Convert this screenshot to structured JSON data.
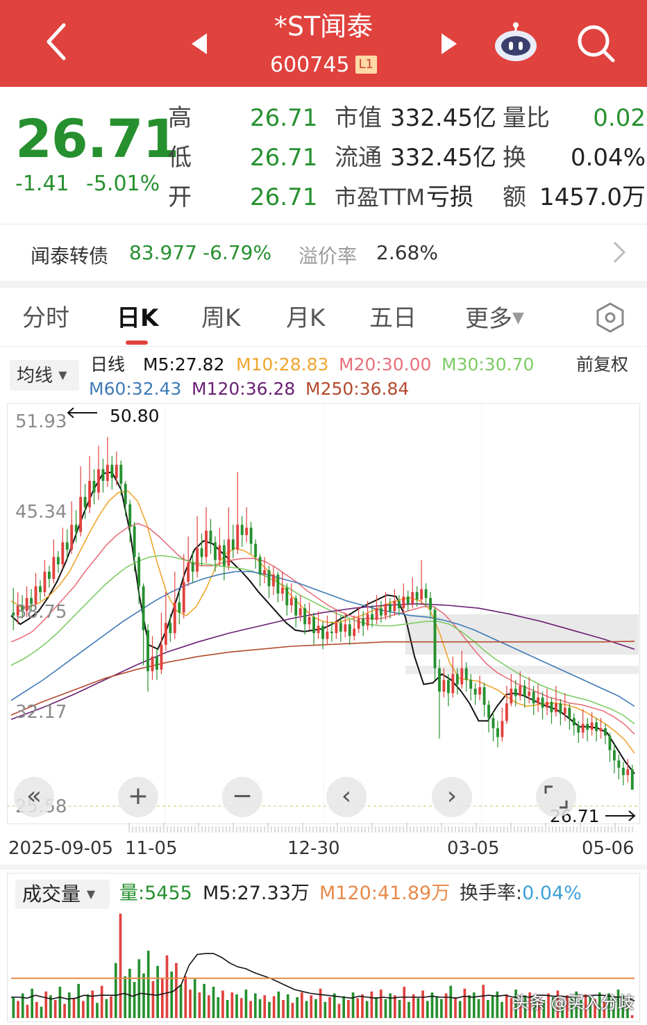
{
  "header": {
    "title": "*ST闻泰",
    "code": "600745",
    "level_badge": "L1"
  },
  "quote": {
    "price": "26.71",
    "change": "-1.41",
    "change_pct": "-5.01%",
    "high_label": "高",
    "high": "26.71",
    "low_label": "低",
    "low": "26.71",
    "open_label": "开",
    "open": "26.71",
    "mktcap_label": "市值",
    "mktcap": "332.45亿",
    "float_label": "流通",
    "float": "332.45亿",
    "pe_label": "市盈TTM",
    "pe": "亏损",
    "volratio_label": "量比",
    "volratio": "0.02",
    "turnover_label": "换",
    "turnover": "0.04%",
    "amount_label": "额",
    "amount": "1457.0万"
  },
  "bond": {
    "name": "闻泰转债",
    "price": "83.977",
    "change_pct": "-6.79%",
    "premium_label": "溢价率",
    "premium": "2.68%"
  },
  "tabs": [
    "分时",
    "日K",
    "周K",
    "月K",
    "五日",
    "更多"
  ],
  "ma_legend": {
    "selector": "均线",
    "prefix": "日线",
    "m5": "M5:27.82",
    "m10": "M10:28.83",
    "m20": "M20:30.00",
    "m30": "M30:30.70",
    "m60": "M60:32.43",
    "m120": "M120:36.28",
    "m250": "M250:36.84",
    "adjust": "前复权"
  },
  "colors": {
    "up": "#e0423e",
    "down": "#26902f",
    "m5": "#111111",
    "m10": "#f0a52c",
    "m20": "#e8707b",
    "m30": "#7ccc63",
    "m60": "#3f7ab8",
    "m120": "#6a1f74",
    "m250": "#b24a2c"
  },
  "chart": {
    "y_ticks": [
      "51.93",
      "45.34",
      "38.75",
      "32.17",
      "25.58"
    ],
    "x_ticks": [
      "2025-09-05",
      "11-05",
      "12-30",
      "03-05",
      "05-06"
    ],
    "max_label": "50.80",
    "last_label": "26.71"
  },
  "chart_data": {
    "type": "candlestick",
    "y_range": [
      25.58,
      51.93
    ],
    "candles": [
      [
        38.8,
        38.6,
        40.5,
        37.6
      ],
      [
        38.6,
        39.3,
        40.2,
        38.0
      ],
      [
        39.3,
        38.9,
        40.0,
        38.4
      ],
      [
        38.9,
        39.8,
        40.6,
        38.5
      ],
      [
        39.8,
        39.4,
        40.4,
        38.9
      ],
      [
        39.4,
        40.6,
        41.5,
        39.0
      ],
      [
        40.6,
        40.2,
        41.0,
        39.6
      ],
      [
        40.2,
        41.6,
        42.4,
        39.9
      ],
      [
        41.6,
        41.1,
        42.0,
        40.5
      ],
      [
        41.1,
        42.6,
        43.8,
        40.8
      ],
      [
        42.6,
        42.1,
        43.0,
        41.5
      ],
      [
        42.1,
        43.6,
        44.6,
        41.8
      ],
      [
        43.6,
        43.1,
        44.5,
        42.4
      ],
      [
        43.1,
        44.8,
        46.4,
        42.8
      ],
      [
        44.8,
        44.3,
        45.8,
        43.6
      ],
      [
        44.3,
        46.7,
        48.8,
        44.0
      ],
      [
        46.7,
        46.0,
        47.6,
        45.2
      ],
      [
        46.0,
        47.8,
        49.5,
        45.6
      ],
      [
        47.8,
        47.0,
        48.6,
        46.2
      ],
      [
        47.0,
        48.6,
        50.2,
        46.5
      ],
      [
        48.6,
        47.8,
        49.3,
        47.0
      ],
      [
        47.8,
        48.9,
        50.8,
        47.4
      ],
      [
        48.9,
        48.0,
        49.5,
        47.2
      ],
      [
        48.0,
        48.9,
        49.8,
        47.5
      ],
      [
        48.9,
        47.6,
        49.2,
        46.8
      ],
      [
        47.6,
        46.2,
        47.8,
        45.4
      ],
      [
        46.2,
        44.7,
        46.5,
        43.6
      ],
      [
        44.7,
        42.6,
        45.0,
        41.6
      ],
      [
        42.6,
        40.6,
        42.9,
        39.4
      ],
      [
        40.6,
        37.6,
        40.8,
        35.2
      ],
      [
        37.6,
        34.8,
        38.0,
        33.4
      ],
      [
        34.8,
        35.8,
        37.2,
        34.2
      ],
      [
        35.8,
        34.9,
        36.4,
        34.2
      ],
      [
        34.9,
        36.6,
        38.8,
        34.6
      ],
      [
        36.6,
        38.1,
        40.2,
        36.2
      ],
      [
        38.1,
        37.4,
        38.7,
        36.8
      ],
      [
        37.4,
        39.5,
        41.6,
        37.0
      ],
      [
        39.5,
        38.8,
        40.3,
        38.0
      ],
      [
        38.8,
        40.9,
        42.8,
        38.4
      ],
      [
        40.9,
        42.2,
        44.0,
        40.6
      ],
      [
        42.2,
        41.6,
        43.0,
        40.8
      ],
      [
        41.6,
        43.2,
        45.4,
        41.2
      ],
      [
        43.2,
        42.6,
        44.2,
        42.0
      ],
      [
        42.6,
        44.4,
        46.0,
        42.2
      ],
      [
        44.4,
        43.6,
        45.2,
        42.8
      ],
      [
        43.6,
        42.4,
        44.0,
        41.6
      ],
      [
        42.4,
        43.4,
        44.6,
        42.0
      ],
      [
        43.4,
        42.0,
        43.8,
        41.0
      ],
      [
        42.0,
        43.8,
        46.0,
        41.7
      ],
      [
        43.8,
        43.1,
        44.8,
        42.5
      ],
      [
        43.1,
        44.8,
        48.4,
        42.8
      ],
      [
        44.8,
        44.1,
        45.4,
        43.3
      ],
      [
        44.1,
        44.6,
        46.0,
        43.6
      ],
      [
        44.6,
        43.5,
        45.0,
        42.8
      ],
      [
        43.5,
        42.6,
        43.8,
        41.8
      ],
      [
        42.6,
        41.4,
        42.8,
        40.6
      ],
      [
        41.4,
        41.7,
        42.6,
        40.8
      ],
      [
        41.7,
        40.6,
        42.0,
        39.8
      ],
      [
        40.6,
        41.4,
        42.0,
        40.0
      ],
      [
        41.4,
        40.1,
        41.6,
        39.5
      ],
      [
        40.1,
        40.5,
        41.6,
        39.6
      ],
      [
        40.5,
        39.3,
        40.8,
        38.6
      ],
      [
        39.3,
        39.8,
        40.8,
        38.8
      ],
      [
        39.8,
        38.6,
        40.0,
        37.8
      ],
      [
        38.6,
        39.1,
        40.0,
        38.2
      ],
      [
        39.1,
        38.0,
        39.4,
        37.3
      ],
      [
        38.0,
        38.5,
        39.5,
        37.6
      ],
      [
        38.5,
        37.4,
        38.8,
        36.6
      ],
      [
        37.4,
        37.9,
        38.9,
        37.0
      ],
      [
        37.9,
        37.0,
        38.2,
        36.3
      ],
      [
        37.0,
        37.5,
        38.6,
        36.6
      ],
      [
        37.5,
        37.4,
        38.2,
        36.8
      ],
      [
        37.4,
        38.1,
        39.0,
        37.0
      ],
      [
        38.1,
        37.5,
        38.6,
        36.8
      ],
      [
        37.5,
        38.0,
        38.8,
        37.1
      ],
      [
        38.0,
        37.2,
        38.3,
        36.6
      ],
      [
        37.2,
        37.7,
        38.6,
        36.9
      ],
      [
        37.7,
        38.4,
        39.2,
        37.4
      ],
      [
        38.4,
        37.9,
        38.9,
        37.2
      ],
      [
        37.9,
        38.7,
        39.6,
        37.6
      ],
      [
        38.7,
        38.3,
        39.3,
        37.8
      ],
      [
        38.3,
        39.1,
        40.0,
        38.0
      ],
      [
        39.1,
        38.6,
        39.6,
        38.1
      ],
      [
        38.6,
        39.4,
        40.2,
        38.3
      ],
      [
        39.4,
        38.9,
        39.8,
        38.4
      ],
      [
        38.9,
        39.6,
        40.4,
        38.6
      ],
      [
        39.6,
        39.1,
        40.0,
        38.6
      ],
      [
        39.1,
        39.9,
        40.8,
        38.8
      ],
      [
        39.9,
        39.4,
        40.3,
        38.9
      ],
      [
        39.4,
        40.2,
        41.2,
        39.1
      ],
      [
        40.2,
        39.7,
        40.6,
        39.2
      ],
      [
        39.7,
        40.4,
        42.4,
        39.4
      ],
      [
        40.4,
        39.8,
        40.8,
        39.2
      ],
      [
        39.8,
        39.0,
        40.2,
        38.4
      ],
      [
        39.0,
        35.0,
        39.2,
        34.2
      ],
      [
        35.0,
        33.4,
        35.6,
        30.2
      ],
      [
        33.4,
        34.2,
        35.0,
        33.0
      ],
      [
        34.2,
        33.3,
        34.6,
        32.4
      ],
      [
        33.3,
        34.6,
        35.8,
        33.0
      ],
      [
        34.6,
        33.9,
        35.0,
        33.2
      ],
      [
        33.9,
        35.0,
        36.2,
        33.6
      ],
      [
        35.0,
        34.2,
        35.4,
        33.4
      ],
      [
        34.2,
        33.6,
        34.6,
        32.8
      ],
      [
        33.6,
        33.2,
        34.0,
        32.5
      ],
      [
        33.2,
        33.7,
        34.5,
        32.8
      ],
      [
        33.7,
        32.5,
        34.0,
        31.7
      ],
      [
        32.5,
        31.6,
        32.8,
        30.6
      ],
      [
        31.6,
        30.9,
        32.0,
        30.0
      ],
      [
        30.9,
        30.3,
        31.4,
        29.6
      ],
      [
        30.3,
        31.4,
        32.3,
        30.0
      ],
      [
        31.4,
        32.6,
        33.8,
        31.2
      ],
      [
        32.6,
        33.6,
        34.6,
        32.4
      ],
      [
        33.6,
        33.1,
        34.2,
        32.4
      ],
      [
        33.1,
        33.8,
        34.8,
        32.8
      ],
      [
        33.8,
        33.1,
        34.2,
        32.3
      ],
      [
        33.1,
        33.4,
        34.4,
        32.6
      ],
      [
        33.4,
        32.6,
        33.8,
        31.8
      ],
      [
        32.6,
        33.0,
        33.9,
        32.0
      ],
      [
        33.0,
        32.3,
        33.4,
        31.5
      ],
      [
        32.3,
        32.7,
        33.6,
        31.8
      ],
      [
        32.7,
        32.0,
        33.0,
        31.2
      ],
      [
        32.0,
        32.6,
        33.8,
        31.7
      ],
      [
        32.6,
        31.9,
        32.9,
        31.1
      ],
      [
        31.9,
        32.3,
        33.3,
        31.4
      ],
      [
        32.3,
        31.6,
        32.6,
        30.8
      ],
      [
        31.6,
        31.1,
        31.9,
        30.4
      ],
      [
        31.1,
        30.6,
        31.4,
        29.9
      ],
      [
        30.6,
        31.2,
        32.2,
        30.2
      ],
      [
        31.2,
        30.8,
        31.6,
        30.0
      ],
      [
        30.8,
        31.3,
        32.0,
        30.4
      ],
      [
        31.3,
        30.7,
        31.6,
        30.0
      ],
      [
        30.7,
        30.9,
        31.6,
        30.2
      ],
      [
        30.9,
        30.4,
        31.2,
        29.8
      ],
      [
        30.4,
        29.4,
        30.6,
        28.6
      ],
      [
        29.4,
        28.7,
        29.8,
        27.8
      ],
      [
        28.7,
        28.2,
        29.1,
        27.4
      ],
      [
        28.2,
        27.7,
        28.6,
        27.0
      ],
      [
        27.7,
        28.1,
        28.8,
        27.2
      ],
      [
        28.1,
        26.7,
        28.4,
        26.7
      ]
    ],
    "ma": {
      "M5": [
        38.6,
        38.0,
        38.4,
        38.9,
        39.8,
        40.9,
        42.3,
        44.0,
        45.7,
        47.2,
        48.3,
        48.4,
        47.2,
        44.2,
        39.9,
        36.6,
        36.3,
        37.7,
        39.6,
        41.6,
        43.1,
        43.7,
        43.5,
        42.9,
        42.3,
        41.7,
        41.0,
        40.2,
        39.5,
        38.8,
        38.1,
        37.6,
        37.5,
        37.6,
        37.7,
        38.0,
        38.4,
        38.7,
        39.1,
        39.4,
        39.7,
        40.0,
        39.9,
        38.5,
        35.8,
        33.9,
        34.0,
        34.6,
        34.2,
        33.5,
        32.6,
        31.4,
        31.4,
        32.4,
        33.2,
        33.3,
        33.1,
        32.8,
        32.5,
        32.3,
        32.0,
        31.5,
        31.0,
        31.0,
        30.9,
        30.6,
        29.6,
        28.6,
        27.8
      ],
      "M10": [
        39.6,
        39.2,
        39.2,
        39.5,
        40.0,
        40.7,
        41.6,
        42.9,
        44.2,
        45.4,
        46.4,
        47.0,
        47.1,
        46.4,
        44.7,
        42.2,
        40.1,
        38.9,
        38.6,
        39.2,
        40.4,
        41.9,
        42.8,
        43.2,
        43.0,
        42.6,
        41.9,
        41.2,
        40.5,
        39.8,
        39.1,
        38.5,
        38.2,
        38.1,
        38.2,
        38.4,
        38.6,
        38.9,
        39.2,
        39.5,
        39.7,
        39.8,
        39.6,
        39.0,
        37.4,
        35.4,
        34.3,
        34.2,
        34.1,
        33.8,
        33.5,
        33.0,
        32.6,
        32.4,
        32.5,
        32.6,
        32.6,
        32.5,
        32.3,
        32.0,
        31.6,
        31.2,
        30.7,
        30.1,
        29.2
      ],
      "M20": [
        36.8,
        37.1,
        37.5,
        38.2,
        39.0,
        39.8,
        40.6,
        41.6,
        42.5,
        43.4,
        44.1,
        44.6,
        44.9,
        44.6,
        44.0,
        43.3,
        42.6,
        42.2,
        42.0,
        42.0,
        42.2,
        42.4,
        42.5,
        42.5,
        42.3,
        41.9,
        41.4,
        40.9,
        40.3,
        39.8,
        39.3,
        38.9,
        38.6,
        38.4,
        38.4,
        38.4,
        38.6,
        38.8,
        39.0,
        39.2,
        39.2,
        38.7,
        37.9,
        37.0,
        36.1,
        35.3,
        34.7,
        34.3,
        33.9,
        33.6,
        33.3,
        33.0,
        32.8,
        32.6,
        32.5,
        32.3,
        32.1,
        31.7,
        31.2,
        30.5
      ],
      "M30": [
        35.2,
        35.6,
        36.1,
        36.7,
        37.4,
        38.2,
        39.0,
        39.8,
        40.6,
        41.3,
        41.9,
        42.3,
        42.6,
        42.7,
        42.6,
        42.4,
        42.2,
        42.1,
        42.0,
        41.9,
        41.8,
        41.6,
        41.3,
        40.9,
        40.5,
        40.0,
        39.6,
        39.2,
        38.8,
        38.5,
        38.2,
        38.0,
        37.9,
        37.9,
        38.0,
        38.1,
        38.2,
        38.2,
        38.0,
        37.5,
        36.9,
        36.2,
        35.6,
        35.1,
        34.6,
        34.2,
        33.8,
        33.5,
        33.2,
        33.0,
        32.8,
        32.5,
        32.2,
        31.8,
        31.2
      ],
      "M60": [
        32.8,
        33.5,
        34.2,
        35.0,
        35.8,
        36.6,
        37.4,
        38.2,
        38.9,
        39.6,
        40.2,
        40.7,
        41.1,
        41.4,
        41.6,
        41.6,
        41.4,
        41.1,
        40.8,
        40.4,
        40.0,
        39.6,
        39.3,
        39.0,
        38.8,
        38.6,
        38.5,
        38.3,
        38.0,
        37.6,
        37.1,
        36.6,
        36.1,
        35.6,
        35.1,
        34.6,
        34.1,
        33.6,
        33.1,
        32.4
      ],
      "M120": [
        31.5,
        32.3,
        33.2,
        34.2,
        35.2,
        36.1,
        36.8,
        37.4,
        37.9,
        38.4,
        38.8,
        39.1,
        39.3,
        39.4,
        39.3,
        39.1,
        38.7,
        38.2,
        37.6,
        37.0,
        36.3
      ],
      "M250": [
        31.8,
        32.7,
        33.5,
        34.3,
        34.9,
        35.4,
        35.8,
        36.1,
        36.3,
        36.5,
        36.6,
        36.7,
        36.8,
        36.8,
        36.8,
        36.8,
        36.8,
        36.8,
        36.8,
        36.8,
        36.84
      ]
    },
    "volume": [
      22,
      18,
      26,
      14,
      31,
      17,
      12,
      28,
      24,
      19,
      33,
      15,
      27,
      21,
      36,
      18,
      25,
      29,
      16,
      34,
      20,
      23,
      58,
      110,
      44,
      52,
      38,
      62,
      47,
      71,
      39,
      55,
      42,
      66,
      49,
      58,
      35,
      44,
      30,
      41,
      27,
      36,
      24,
      33,
      22,
      29,
      19,
      27,
      25,
      21,
      30,
      18,
      26,
      20,
      24,
      17,
      23,
      28,
      19,
      25,
      16,
      22,
      27,
      18,
      24,
      20,
      31,
      17,
      22,
      26,
      15,
      23,
      19,
      27,
      21,
      25,
      18,
      28,
      22,
      30,
      20,
      26,
      24,
      19,
      33,
      17,
      25,
      21,
      29,
      18,
      27,
      23,
      20,
      26,
      34,
      22,
      18,
      31,
      24,
      27,
      20,
      35,
      19,
      23,
      28,
      17,
      25,
      21,
      30,
      18,
      24,
      27,
      20,
      23,
      19,
      26,
      22,
      29,
      17,
      24,
      21,
      28,
      19,
      25,
      23,
      20,
      27,
      18,
      26,
      22,
      30,
      24,
      16,
      3
    ],
    "volume_ma5": [
      22,
      22,
      21,
      24,
      22,
      20,
      22,
      20,
      21,
      24,
      23,
      24,
      24,
      24,
      26,
      23,
      26,
      25,
      24,
      26,
      28,
      35,
      56,
      67,
      68,
      68,
      64,
      58,
      54,
      52,
      48,
      45,
      42,
      38,
      34,
      30,
      28,
      26,
      25,
      24,
      23,
      22,
      21,
      23,
      22,
      21,
      22,
      21,
      22,
      22,
      22,
      22,
      23,
      22,
      22,
      21,
      23,
      22,
      23,
      24,
      23,
      24,
      22,
      23,
      22,
      24,
      24,
      23,
      23,
      22,
      24,
      23,
      24,
      24,
      23,
      22,
      22,
      18
    ],
    "volume_ma120": 41.89
  },
  "volume_panel": {
    "selector": "成交量",
    "vol": "量:5455",
    "m5": "M5:27.33万",
    "m120": "M120:41.89万",
    "turnover_label": "换手率:",
    "turnover": "0.04%"
  },
  "watermark": "头条 @买入分歧"
}
